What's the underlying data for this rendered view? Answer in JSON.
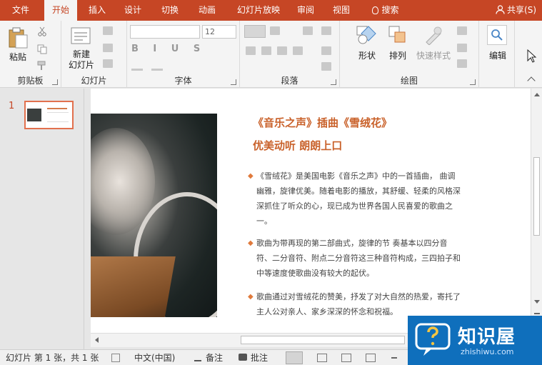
{
  "tabs": [
    {
      "label": "文件"
    },
    {
      "label": "开始",
      "active": true
    },
    {
      "label": "插入"
    },
    {
      "label": "设计"
    },
    {
      "label": "切换"
    },
    {
      "label": "动画"
    },
    {
      "label": "幻灯片放映"
    },
    {
      "label": "审阅"
    },
    {
      "label": "视图"
    }
  ],
  "search_label": "搜索",
  "share_label": "共享(S)",
  "ribbon": {
    "clipboard": {
      "label": "剪贴板",
      "paste": "粘贴"
    },
    "slides": {
      "label": "幻灯片",
      "new_slide_line1": "新建",
      "new_slide_line2": "幻灯片"
    },
    "font": {
      "label": "字体",
      "font_name": "",
      "font_size": "12"
    },
    "paragraph": {
      "label": "段落"
    },
    "drawing": {
      "label": "绘图",
      "shape": "形状",
      "arrange": "排列",
      "quick_styles": "快速样式"
    },
    "editing": {
      "label": "编辑"
    }
  },
  "thumbnail": {
    "number": "1"
  },
  "slide": {
    "title1": "《音乐之声》插曲《雪绒花》",
    "title2": "优美动听 朗朗上口",
    "bullet_glyph": "◆",
    "paragraphs": [
      "《雪绒花》是美国电影《音乐之声》中的一首插曲， 曲调幽雅，旋律优美。随着电影的播放，其舒缓、轻柔的风格深深抓住了听众的心，现已成为世界各国人民喜爱的歌曲之一。",
      "歌曲为带再现的第二部曲式，旋律的节 奏基本以四分音符、二分音符、附点二分音符这三种音符构成，三四拍子和中等速度使歌曲没有较大的起伏。",
      "歌曲通过对雪绒花的赞美，抒发了对大自然的热爱，寄托了主人公对亲人、家乡深深的怀念和祝福。"
    ]
  },
  "status": {
    "slide_info": "幻灯片 第 1 张，共 1 张",
    "language": "中文(中国)",
    "notes": "备注",
    "comments": "批注"
  },
  "watermark": {
    "title": "知识屋",
    "url": "zhishiwu.com"
  },
  "colors": {
    "accent": "#c64625",
    "title_text": "#c9612a",
    "bullet": "#e07a3c",
    "watermark_bg": "#0f6fbc"
  }
}
